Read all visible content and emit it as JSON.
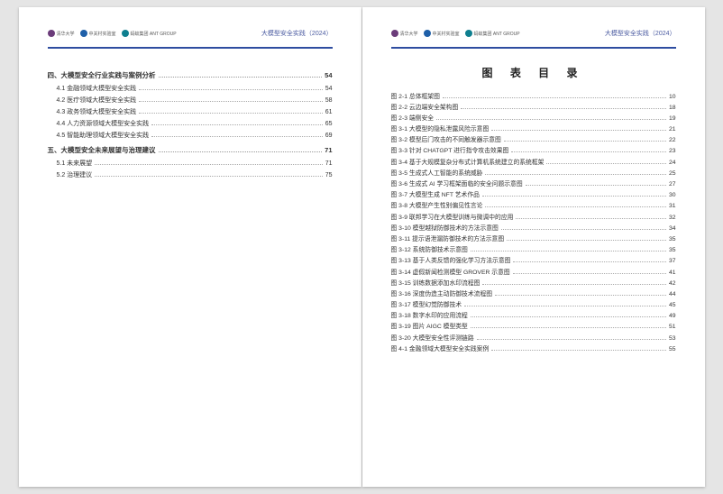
{
  "header": {
    "logos": [
      {
        "name": "清华大学",
        "color": "lc-purple"
      },
      {
        "name": "中关村实验室",
        "color": "lc-blue"
      },
      {
        "name": "蚂蚁集团 ANT GROUP",
        "color": "lc-teal"
      }
    ],
    "doc_title": "大模型安全实践（2024）"
  },
  "left_page": {
    "sections": [
      {
        "title": "四、大模型安全行业实践与案例分析",
        "page": "54",
        "items": [
          {
            "label": "4.1 金融领域大模型安全实践",
            "page": "54"
          },
          {
            "label": "4.2 医疗领域大模型安全实践",
            "page": "58"
          },
          {
            "label": "4.3 政务领域大模型安全实践",
            "page": "61"
          },
          {
            "label": "4.4 人力资源领域大模型安全实践",
            "page": "65"
          },
          {
            "label": "4.5 智能助理领域大模型安全实践",
            "page": "69"
          }
        ]
      },
      {
        "title": "五、大模型安全未来展望与治理建议",
        "page": "71",
        "items": [
          {
            "label": "5.1 未来展望",
            "page": "71"
          },
          {
            "label": "5.2 治理建议",
            "page": "75"
          }
        ]
      }
    ]
  },
  "right_page": {
    "heading": "图 表 目 录",
    "figures": [
      {
        "label": "图 2-1 总体框架图",
        "page": "10"
      },
      {
        "label": "图 2-2 云边端安全架构图",
        "page": "18"
      },
      {
        "label": "图 2-3 端侧安全",
        "page": "19"
      },
      {
        "label": "图 3-1 大模型的隐私泄露风险示意图",
        "page": "21"
      },
      {
        "label": "图 3-2 模型后门攻击的不同触发器示意图",
        "page": "22"
      },
      {
        "label": "图 3-3 针对 CHATGPT 进行指令攻击效果图",
        "page": "23"
      },
      {
        "label": "图 3-4 基于大规模复杂分布式计算机系统建立的系统框架",
        "page": "24"
      },
      {
        "label": "图 3-5 生成式人工智能的系统威胁",
        "page": "25"
      },
      {
        "label": "图 3-6 生成式 AI 学习框架面临的安全问题示意图",
        "page": "27"
      },
      {
        "label": "图 3-7 大模型生成 NFT 艺术作品",
        "page": "30"
      },
      {
        "label": "图 3-8 大模型产生性别偏见性言论",
        "page": "31"
      },
      {
        "label": "图 3-9 联邦学习在大模型训练与微调中的应用",
        "page": "32"
      },
      {
        "label": "图 3-10 模型越狱防御技术的方法示意图",
        "page": "34"
      },
      {
        "label": "图 3-11 提示语泄漏防御技术的方法示意图",
        "page": "35"
      },
      {
        "label": "图 3-12 系统防御技术示意图",
        "page": "35"
      },
      {
        "label": "图 3-13 基于人类反馈的强化学习方法示意图",
        "page": "37"
      },
      {
        "label": "图 3-14 虚假新闻检测模型 GROVER 示意图",
        "page": "41"
      },
      {
        "label": "图 3-15 训练数据添加水印流程图",
        "page": "42"
      },
      {
        "label": "图 3-16 深度伪造主动防御技术流程图",
        "page": "44"
      },
      {
        "label": "图 3-17 模型幻觉防御技术",
        "page": "45"
      },
      {
        "label": "图 3-18 数字水印的应用流程",
        "page": "49"
      },
      {
        "label": "图 3-19 图片 AIGC 模型类型",
        "page": "51"
      },
      {
        "label": "图 3-20 大模型安全性评测链路",
        "page": "53"
      },
      {
        "label": "图 4-1 金融领域大模型安全实践案例",
        "page": "55"
      }
    ]
  }
}
